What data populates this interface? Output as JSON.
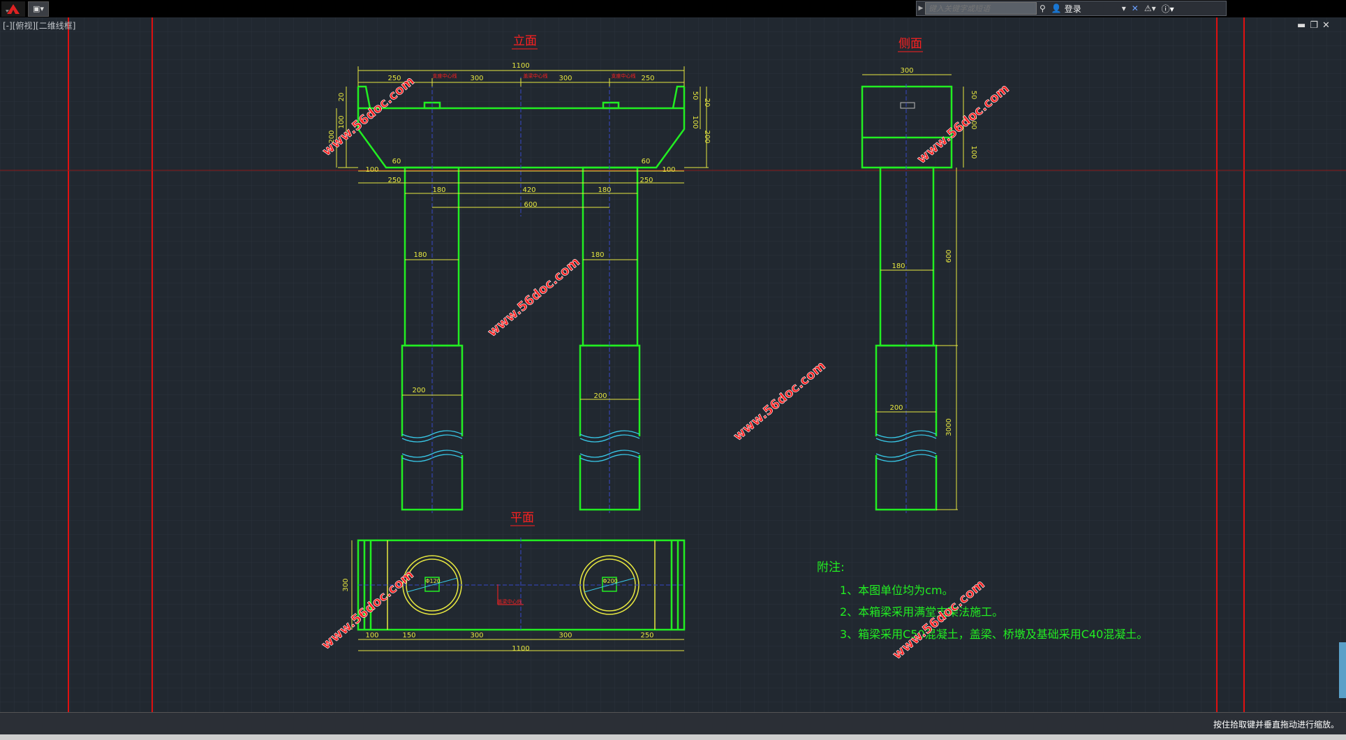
{
  "app": {
    "logo_icon": "autocad-logo-icon",
    "quick_access_icon": "save-document-icon"
  },
  "infocenter": {
    "search_placeholder": "键入关键字或短语",
    "login_label": "登录"
  },
  "viewport_label": "[-][俯视][二维线框]",
  "drawing": {
    "title_elevation": "立面",
    "title_side": "侧面",
    "title_plan": "平面",
    "watermark": "www.56doc.com",
    "dims_elevation": {
      "d1100": "1100",
      "d250a": "250",
      "d300a": "300",
      "d300b": "300",
      "d250b": "250",
      "d60a": "60",
      "d60b": "60",
      "d100a": "100",
      "d100b": "100",
      "d250c": "250",
      "d250d": "250",
      "d180a": "180",
      "d420": "420",
      "d180b": "180",
      "d600": "600",
      "d180c": "180",
      "d180d": "180",
      "d200a": "200",
      "d200b": "200",
      "r50": "50",
      "r20": "20",
      "r100": "100",
      "r200": "200",
      "l20": "20",
      "l100": "100",
      "l200": "200",
      "tag1": "支座中心线",
      "tag2": "盖梁中心线",
      "tag3": "支座中心线"
    },
    "dims_side": {
      "d300": "300",
      "d180": "180",
      "d200": "200",
      "d600": "600",
      "d3000": "3000",
      "r50": "50",
      "r100a": "100",
      "r100b": "100"
    },
    "dims_plan": {
      "d300": "300",
      "d100": "100",
      "d150": "150",
      "d300a": "300",
      "d300b": "300",
      "d250": "250",
      "d1100": "1100",
      "c1": "Φ120",
      "c2": "Φ200",
      "tag": "盖梁中心线"
    },
    "notes": {
      "heading": "附注:",
      "n1": "1、本图单位均为cm。",
      "n2": "2、本箱梁采用满堂支架法施工。",
      "n3": "3、箱梁采用C50混凝土，盖梁、桥墩及基础采用C40混凝土。"
    }
  },
  "status_text": "按住拾取键并垂直拖动进行缩放。"
}
